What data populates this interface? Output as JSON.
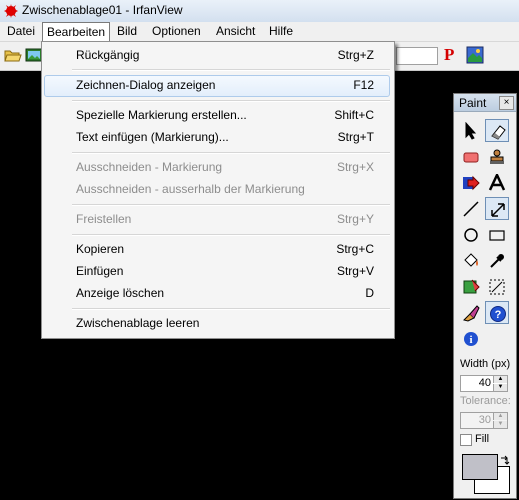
{
  "window": {
    "title": "Zwischenablage01 - IrfanView"
  },
  "menubar": {
    "items": [
      {
        "label": "Datei"
      },
      {
        "label": "Bearbeiten"
      },
      {
        "label": "Bild"
      },
      {
        "label": "Optionen"
      },
      {
        "label": "Ansicht"
      },
      {
        "label": "Hilfe"
      }
    ]
  },
  "toolbar": {
    "p_label": "P"
  },
  "edit_menu": {
    "items": [
      {
        "label": "Rückgängig",
        "shortcut": "Strg+Z",
        "enabled": true
      },
      {
        "label": "Zeichnen-Dialog anzeigen",
        "shortcut": "F12",
        "enabled": true,
        "highlighted": true
      },
      {
        "label": "Spezielle Markierung erstellen...",
        "shortcut": "Shift+C",
        "enabled": true
      },
      {
        "label": "Text einfügen (Markierung)...",
        "shortcut": "Strg+T",
        "enabled": true
      },
      {
        "label": "Ausschneiden - Markierung",
        "shortcut": "Strg+X",
        "enabled": false
      },
      {
        "label": "Ausschneiden - ausserhalb der Markierung",
        "shortcut": "",
        "enabled": false
      },
      {
        "label": "Freistellen",
        "shortcut": "Strg+Y",
        "enabled": false
      },
      {
        "label": "Kopieren",
        "shortcut": "Strg+C",
        "enabled": true
      },
      {
        "label": "Einfügen",
        "shortcut": "Strg+V",
        "enabled": true
      },
      {
        "label": "Anzeige löschen",
        "shortcut": "D",
        "enabled": true
      },
      {
        "label": "Zwischenablage leeren",
        "shortcut": "",
        "enabled": true
      }
    ]
  },
  "paint": {
    "title": "Paint",
    "close": "×",
    "width_label": "Width (px)",
    "width_value": "40",
    "tolerance_label": "Tolerance:",
    "tolerance_value": "30",
    "fill_label": "Fill",
    "foreground_color": "#c0c0c8",
    "background_color": "#ffffff"
  },
  "colors": {
    "canvas": "#000000",
    "accent_red": "#d40000"
  }
}
